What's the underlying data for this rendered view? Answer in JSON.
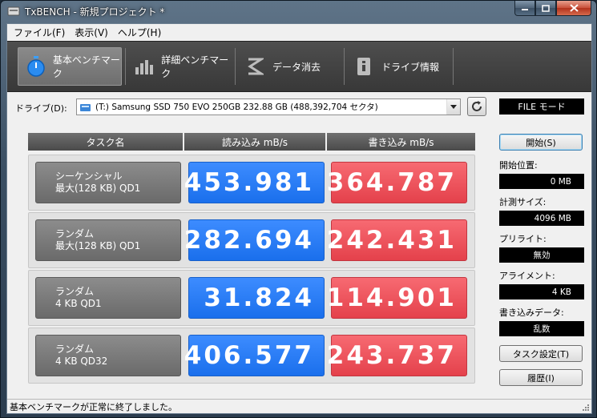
{
  "window": {
    "title": "TxBENCH - 新規プロジェクト *"
  },
  "menu": [
    {
      "label": "ファイル(F)"
    },
    {
      "label": "表示(V)"
    },
    {
      "label": "ヘルプ(H)"
    }
  ],
  "toolbar": {
    "tabs": [
      {
        "label": "基本ベンチマーク",
        "icon": "stopwatch-icon",
        "active": true
      },
      {
        "label": "詳細ベンチマーク",
        "icon": "bar-chart-icon",
        "active": false
      },
      {
        "label": "データ消去",
        "icon": "eraser-icon",
        "active": false
      },
      {
        "label": "ドライブ情報",
        "icon": "drive-info-icon",
        "active": false
      }
    ]
  },
  "drive": {
    "label": "ドライブ(D):",
    "selected": "(T:) Samsung SSD 750 EVO 250GB  232.88 GB (488,392,704 セクタ)",
    "mode": "FILE モード"
  },
  "table": {
    "headers": [
      "タスク名",
      "読み込み mB/s",
      "書き込み mB/s"
    ],
    "rows": [
      {
        "task_line1": "シーケンシャル",
        "task_line2": "最大(128 KB) QD1",
        "read": "453.981",
        "write": "364.787"
      },
      {
        "task_line1": "ランダム",
        "task_line2": "最大(128 KB) QD1",
        "read": "282.694",
        "write": "242.431"
      },
      {
        "task_line1": "ランダム",
        "task_line2": "4 KB QD1",
        "read": "31.824",
        "write": "114.901"
      },
      {
        "task_line1": "ランダム",
        "task_line2": "4 KB QD32",
        "read": "406.577",
        "write": "243.737"
      }
    ]
  },
  "side": {
    "start_button": "開始(S)",
    "start_pos_label": "開始位置:",
    "start_pos_value": "0 MB",
    "measure_size_label": "計測サイズ:",
    "measure_size_value": "4096 MB",
    "prewrite_label": "プリライト:",
    "prewrite_value": "無効",
    "alignment_label": "アライメント:",
    "alignment_value": "4 KB",
    "write_data_label": "書き込みデータ:",
    "write_data_value": "乱数",
    "task_settings_button": "タスク設定(T)",
    "history_button": "履歴(I)"
  },
  "status": {
    "text": "基本ベンチマークが正常に終了しました。"
  },
  "colors": {
    "read": "#2a7df5",
    "write": "#ec525b",
    "toolbar": "#444444"
  }
}
